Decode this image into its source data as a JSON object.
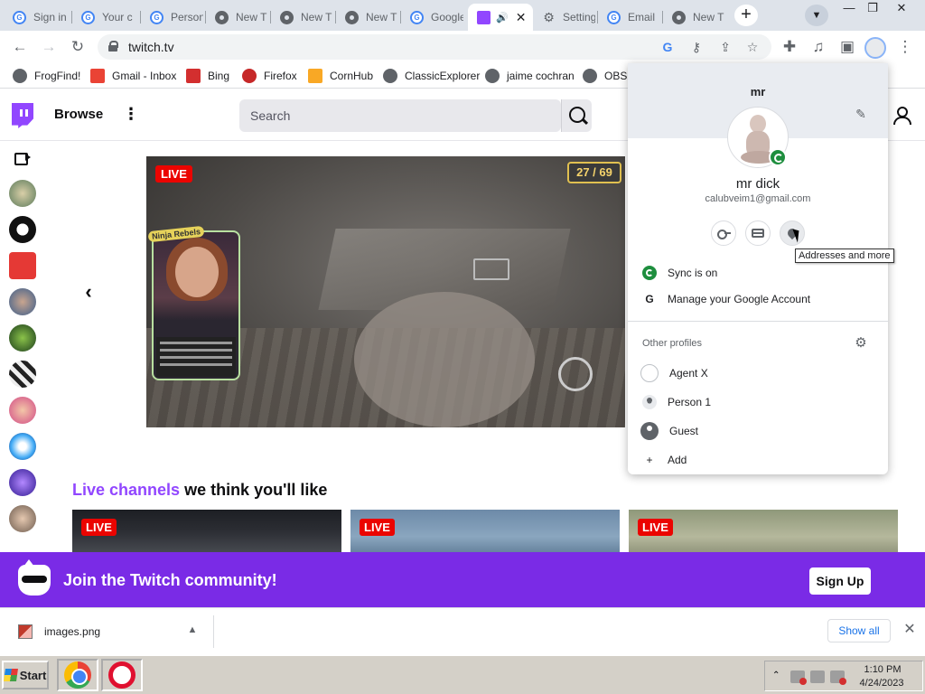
{
  "browser": {
    "tabs": [
      {
        "label": "Sign in",
        "icon": "google-icon"
      },
      {
        "label": "Your c",
        "icon": "google-icon"
      },
      {
        "label": "Person",
        "icon": "google-icon"
      },
      {
        "label": "New T",
        "icon": "chrome-icon"
      },
      {
        "label": "New T",
        "icon": "chrome-icon"
      },
      {
        "label": "New T",
        "icon": "chrome-icon"
      },
      {
        "label": "Google",
        "icon": "google-icon"
      },
      {
        "label": "",
        "icon": "twitch-icon",
        "active": true
      },
      {
        "label": "Setting",
        "icon": "gear-icon"
      },
      {
        "label": "Email",
        "icon": "google-icon"
      },
      {
        "label": "New T",
        "icon": "chrome-icon"
      }
    ],
    "active_tab_close": "✕",
    "new_tab": "+",
    "window": {
      "minimize": "—",
      "restore": "❐",
      "close": "✕"
    },
    "url": "twitch.tv",
    "bookmarks": [
      {
        "label": "FrogFind!",
        "color": "#5f6368"
      },
      {
        "label": "Gmail - Inbox",
        "color": "#ea4335"
      },
      {
        "label": "Bing",
        "color": "#d32f2f"
      },
      {
        "label": "Firefox",
        "color": "#c62828"
      },
      {
        "label": "CornHub",
        "color": "#f9a825"
      },
      {
        "label": "ClassicExplorer",
        "color": "#5f6368"
      },
      {
        "label": "jaime cochran",
        "color": "#5f6368"
      },
      {
        "label": "OBS",
        "color": "#5f6368"
      }
    ]
  },
  "twitch": {
    "nav": {
      "browse": "Browse",
      "more": "⋮",
      "search_placeholder": "Search"
    },
    "player": {
      "live": "LIVE",
      "counter": "27 / 69",
      "overlay_tag": "Ninja Rebels"
    },
    "carousel_prev": "‹",
    "recommended": {
      "accent": "Live channels",
      "rest": " we think you'll like"
    },
    "thumbs": [
      {
        "live": "LIVE"
      },
      {
        "live": "LIVE"
      },
      {
        "live": "LIVE"
      }
    ],
    "banner": {
      "text": "Join the Twitch community!",
      "signup": "Sign Up"
    },
    "brand_color": "#9146ff"
  },
  "profile_menu": {
    "short_name": "mr",
    "name": "mr dick",
    "email": "calubveim1@gmail.com",
    "tooltip": "Addresses and more",
    "sync": "Sync is on",
    "manage": "Manage your Google Account",
    "other_profiles_label": "Other profiles",
    "profiles": [
      {
        "name": "Agent X",
        "icon": "blank-avatar-icon"
      },
      {
        "name": "Person 1",
        "icon": "person-avatar-icon"
      },
      {
        "name": "Guest",
        "icon": "guest-avatar-icon"
      }
    ],
    "add": "Add"
  },
  "downloads": {
    "file": "images.png",
    "show_all": "Show all"
  },
  "taskbar": {
    "start": "Start",
    "time": "1:10 PM",
    "date": "4/24/2023"
  }
}
